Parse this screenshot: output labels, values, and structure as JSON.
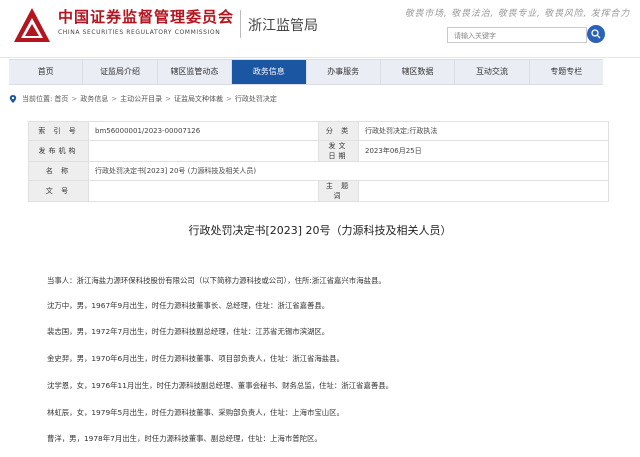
{
  "header": {
    "brand_cn": "中国证券监督管理委员会",
    "brand_en": "CHINA SECURITIES REGULATORY COMMISSION",
    "local": "浙江监管局",
    "slogan": "敬畏市场, 敬畏法治, 敬畏专业, 敬畏风险, 发挥合力",
    "search_placeholder": "请输入关键字",
    "brand_color": "#b4141e",
    "accent": "#1b56a3"
  },
  "nav": {
    "items": [
      "首页",
      "证监局介绍",
      "辖区监管动态",
      "政务信息",
      "办事服务",
      "辖区数据",
      "互动交流",
      "专题专栏"
    ],
    "active_index": 3
  },
  "breadcrumb": {
    "prefix": "当前位置:",
    "items": [
      "首页",
      "政务信息",
      "主动公开目录",
      "证监局文种体裁",
      "行政处罚决定"
    ]
  },
  "meta": {
    "rows": [
      {
        "l1": "索 引 号",
        "v1": "bm56000001/2023-00007126",
        "l2": "分    类",
        "v2": "行政处罚决定;行政执法"
      },
      {
        "l1": "发布机构",
        "v1": "",
        "l2": "发文日期",
        "v2": "2023年06月25日"
      },
      {
        "l1": "名    称",
        "v1": "行政处罚决定书[2023] 20号 (力源科技及相关人员)",
        "l2": "",
        "v2": ""
      },
      {
        "l1": "文    号",
        "v1": "",
        "l2": "主 题 词",
        "v2": ""
      }
    ]
  },
  "doc": {
    "title": "行政处罚决定书[2023] 20号（力源科技及相关人员）",
    "paragraphs": [
      "当事人：浙江海盐力源环保科技股份有限公司（以下简称力源科技或公司），住所:浙江省嘉兴市海盐县。",
      "沈万中，男，1967年9月出生，时任力源科技董事长、总经理，住址：浙江省嘉善县。",
      "裴志国，男，1972年7月出生，时任力源科技副总经理，住址：江苏省无锡市滨湖区。",
      "金史羿，男，1970年6月出生，时任力源科技董事、项目部负责人，住址：浙江省海盐县。",
      "沈学恩，女，1976年11月出生，时任力源科技副总经理、董事会秘书、财务总监，住址：浙江省嘉善县。",
      "林虹辰，女，1979年5月出生，时任力源科技董事、采购部负责人，住址：上海市宝山区。",
      "曹洋，男，1978年7月出生，时任力源科技董事、副总经理，住址：上海市普陀区。"
    ]
  }
}
